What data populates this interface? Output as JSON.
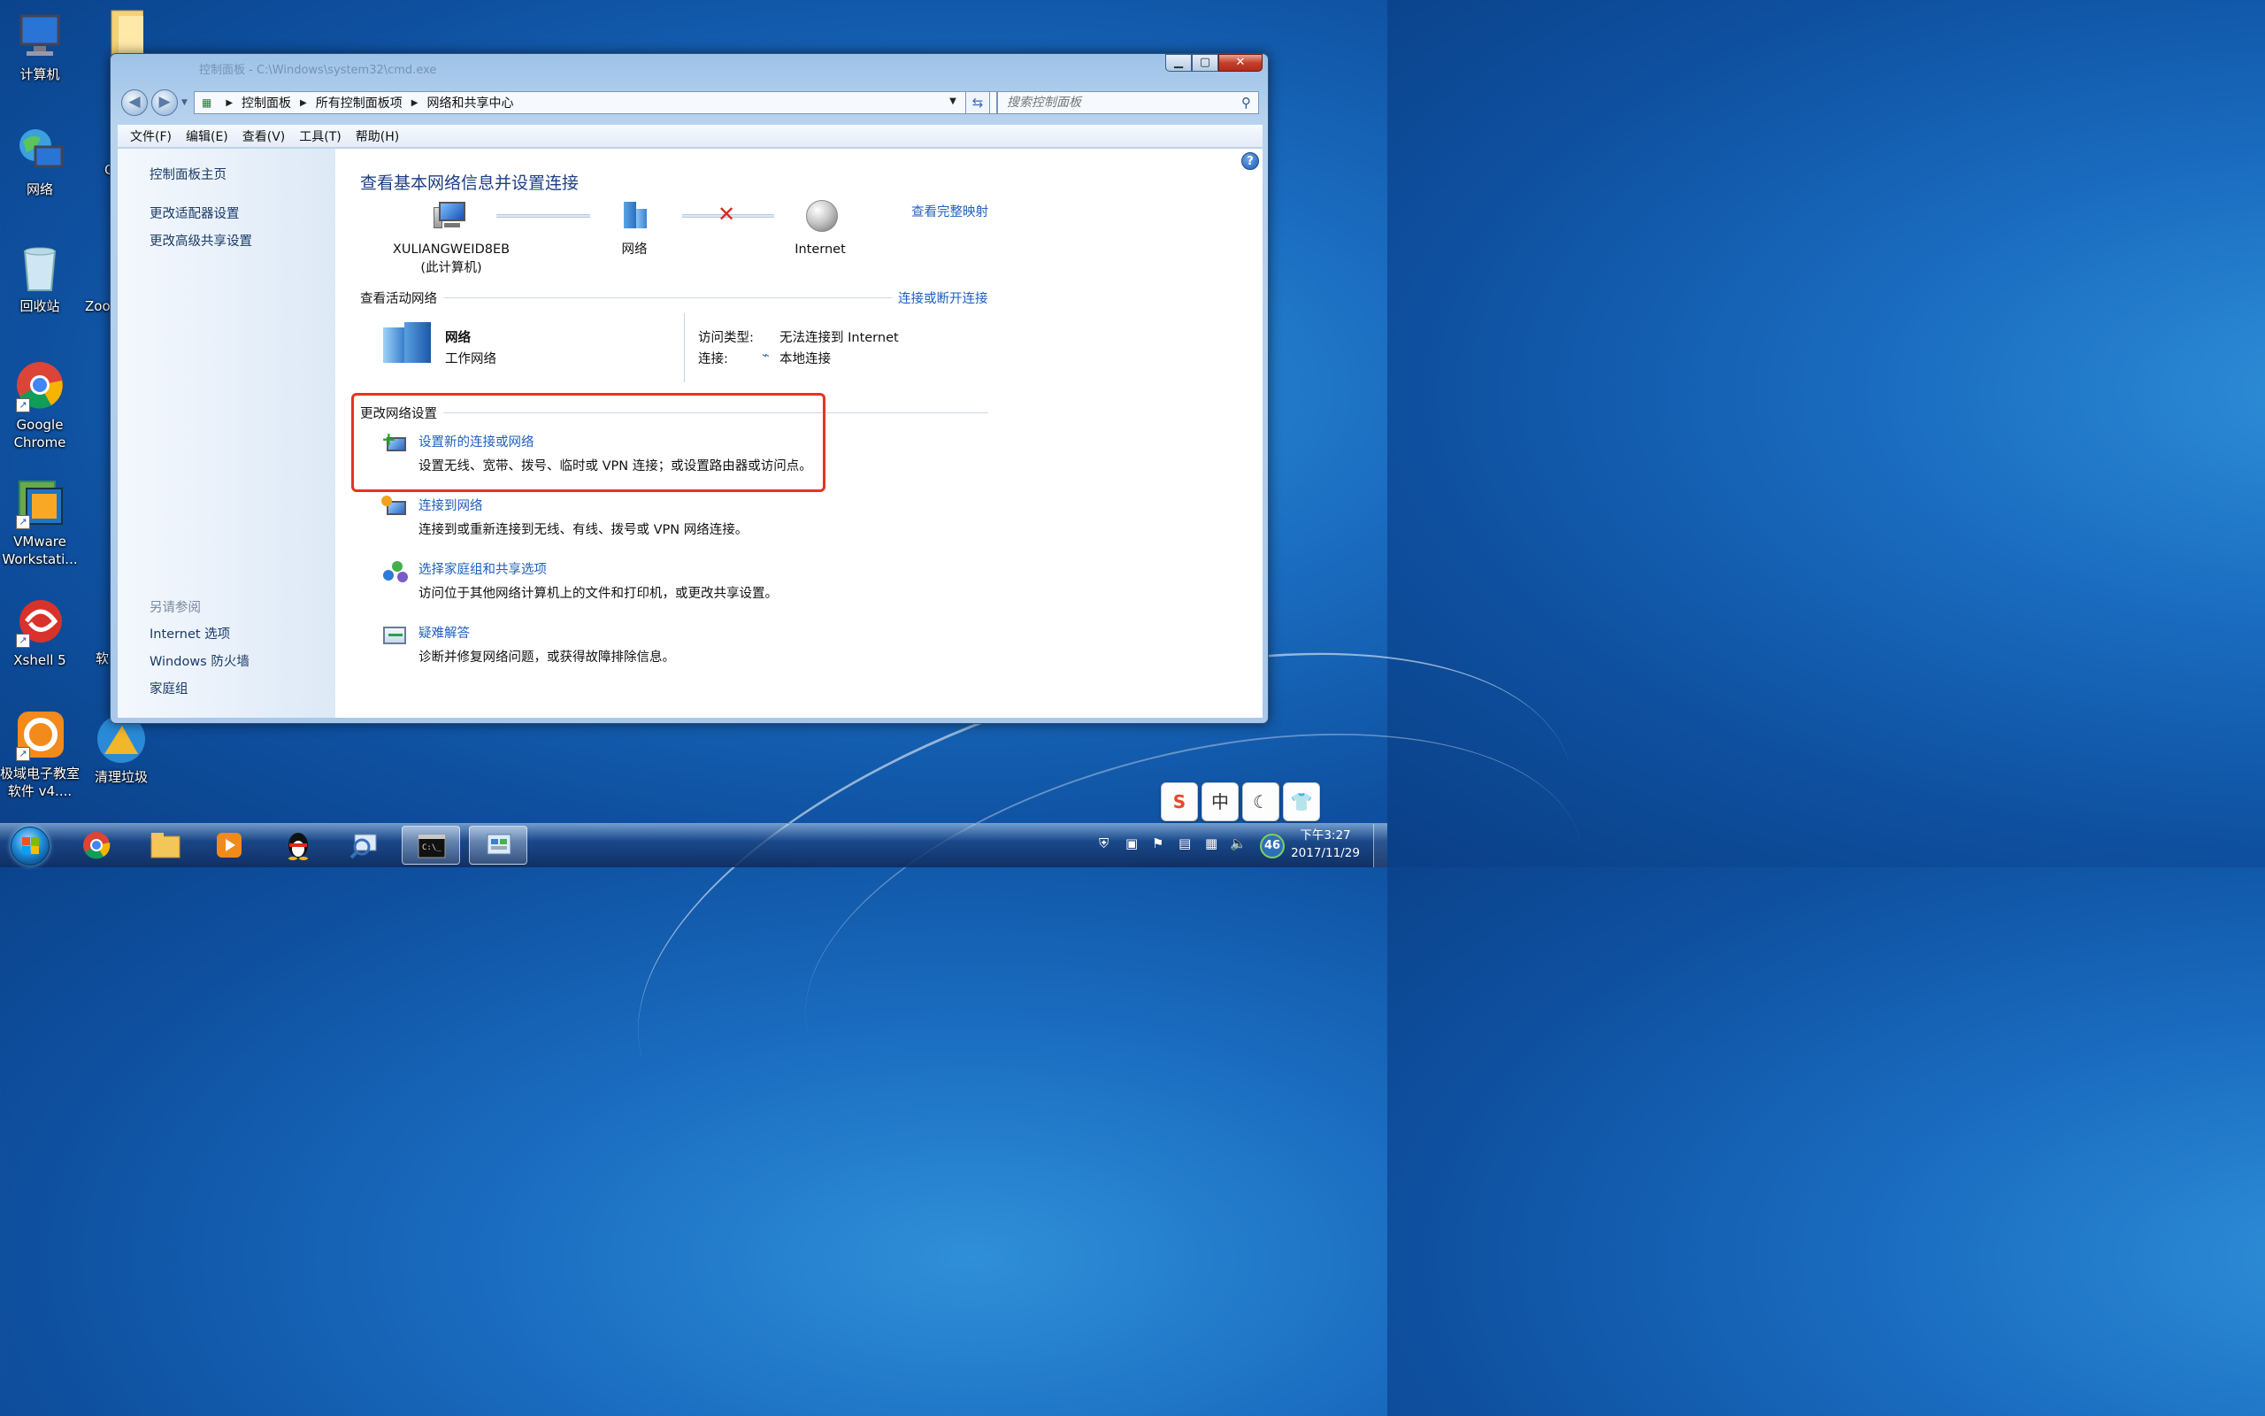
{
  "desktop": {
    "icons": [
      {
        "label": "计算机"
      },
      {
        "label": "网络"
      },
      {
        "label": "回收站"
      },
      {
        "label": "Google Chrome"
      },
      {
        "label": "VMware Workstati..."
      },
      {
        "label": "Xshell 5"
      },
      {
        "label": "极域电子教室软件 v4...."
      },
      {
        "label": "清理垃圾"
      }
    ],
    "partial_labels": [
      "Q",
      "Zoo",
      "软"
    ]
  },
  "window": {
    "ghost_title": "控制面板 - C:\\Windows\\system32\\cmd.exe",
    "caption": {
      "minimize": "▁",
      "maximize": "▢",
      "close": "✕"
    },
    "address": {
      "crumbs": [
        "控制面板",
        "所有控制面板项",
        "网络和共享中心"
      ],
      "search_placeholder": "搜索控制面板"
    },
    "menu": [
      "文件(F)",
      "编辑(E)",
      "查看(V)",
      "工具(T)",
      "帮助(H)"
    ],
    "left_pane": {
      "home": "控制面板主页",
      "links": [
        "更改适配器设置",
        "更改高级共享设置"
      ],
      "see_also_title": "另请参阅",
      "see_also": [
        "Internet 选项",
        "Windows 防火墙",
        "家庭组"
      ]
    },
    "main": {
      "title": "查看基本网络信息并设置连接",
      "full_map_link": "查看完整映射",
      "map": {
        "computer_name": "XULIANGWEID8EB",
        "computer_sub": "(此计算机)",
        "network": "网络",
        "internet": "Internet"
      },
      "active_section": {
        "title": "查看活动网络",
        "link": "连接或断开连接",
        "network_name": "网络",
        "network_type": "工作网络",
        "access_label": "访问类型:",
        "access_value": "无法连接到 Internet",
        "conn_label": "连接:",
        "conn_value": "本地连接"
      },
      "change_section": {
        "title": "更改网络设置",
        "tasks": [
          {
            "title": "设置新的连接或网络",
            "desc": "设置无线、宽带、拨号、临时或 VPN 连接；或设置路由器或访问点。"
          },
          {
            "title": "连接到网络",
            "desc": "连接到或重新连接到无线、有线、拨号或 VPN 网络连接。"
          },
          {
            "title": "选择家庭组和共享选项",
            "desc": "访问位于其他网络计算机上的文件和打印机，或更改共享设置。"
          },
          {
            "title": "疑难解答",
            "desc": "诊断并修复网络问题，或获得故障排除信息。"
          }
        ]
      },
      "help": "?"
    }
  },
  "ime_bar": [
    "S",
    "中",
    "☾",
    "👕"
  ],
  "taskbar": {
    "tray_badge": "46",
    "clock_time": "下午3:27",
    "clock_date": "2017/11/29"
  }
}
